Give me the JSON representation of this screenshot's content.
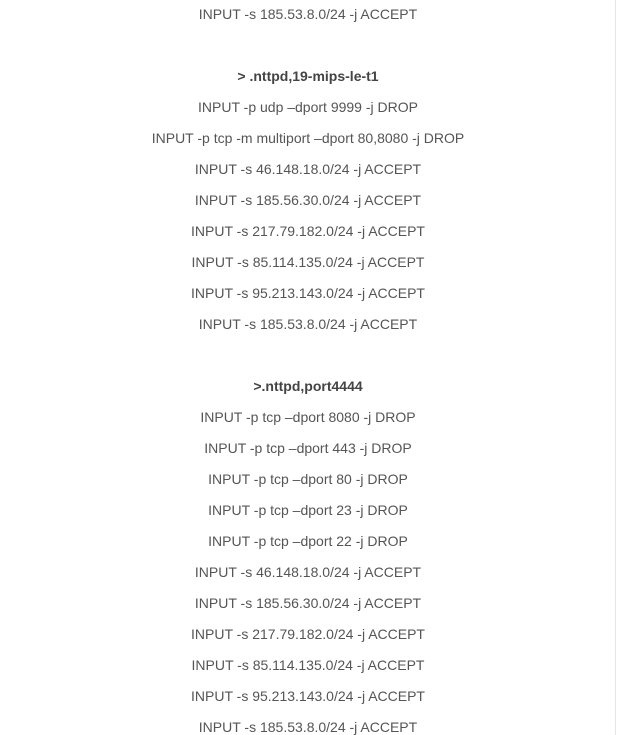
{
  "sections": [
    {
      "heading": "",
      "rules": [
        "INPUT -s 185.53.8.0/24 -j ACCEPT"
      ]
    },
    {
      "heading": "> .nttpd,19-mips-le-t1",
      "rules": [
        "INPUT -p udp –dport 9999 -j DROP",
        "INPUT -p tcp -m multiport –dport 80,8080 -j DROP",
        "INPUT -s 46.148.18.0/24 -j ACCEPT",
        "INPUT -s 185.56.30.0/24 -j ACCEPT",
        "INPUT -s 217.79.182.0/24 -j ACCEPT",
        "INPUT -s 85.114.135.0/24 -j ACCEPT",
        "INPUT -s 95.213.143.0/24 -j ACCEPT",
        "INPUT -s 185.53.8.0/24 -j ACCEPT"
      ]
    },
    {
      "heading": ">.nttpd,port4444",
      "rules": [
        "INPUT -p tcp –dport 8080 -j DROP",
        "INPUT -p tcp –dport 443 -j DROP",
        "INPUT -p tcp –dport 80 -j DROP",
        "INPUT -p tcp –dport 23 -j DROP",
        "INPUT -p tcp –dport 22 -j DROP",
        "INPUT -s 46.148.18.0/24 -j ACCEPT",
        "INPUT -s 185.56.30.0/24 -j ACCEPT",
        "INPUT -s 217.79.182.0/24 -j ACCEPT",
        "INPUT -s 85.114.135.0/24 -j ACCEPT",
        "INPUT -s 95.213.143.0/24 -j ACCEPT",
        "INPUT -s 185.53.8.0/24 -j ACCEPT"
      ]
    }
  ]
}
